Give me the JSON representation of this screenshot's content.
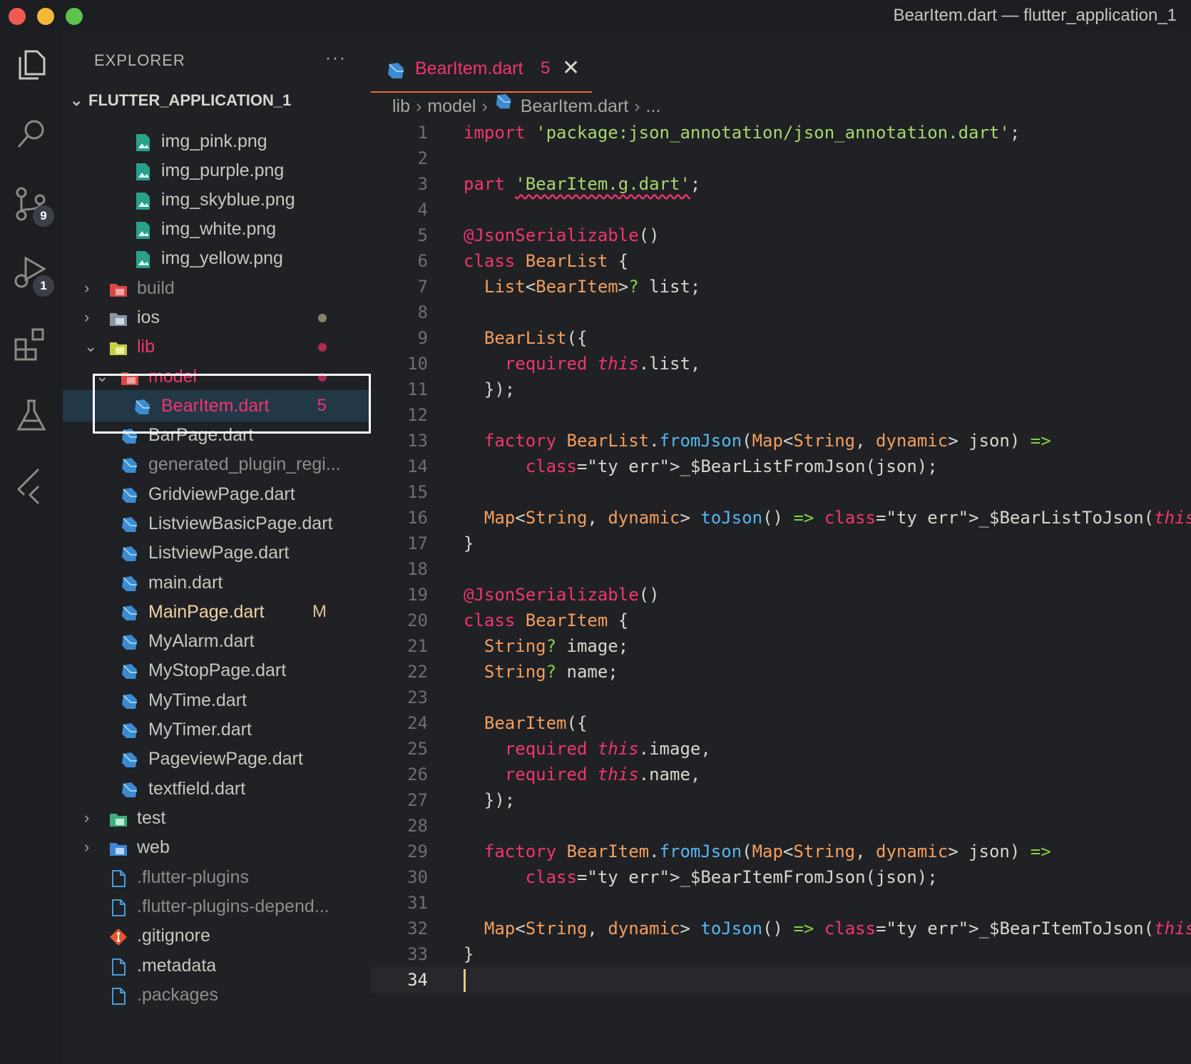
{
  "window": {
    "title": "BearItem.dart — flutter_application_1"
  },
  "activity_bar": {
    "source_control_badge": "9",
    "run_debug_badge": "1"
  },
  "explorer": {
    "header": "EXPLORER",
    "more_label": "···",
    "project": "FLUTTER_APPLICATION_1",
    "items": [
      {
        "label": "img_pink.png"
      },
      {
        "label": "img_purple.png"
      },
      {
        "label": "img_skyblue.png"
      },
      {
        "label": "img_white.png"
      },
      {
        "label": "img_yellow.png"
      },
      {
        "label": "build"
      },
      {
        "label": "ios"
      },
      {
        "label": "lib"
      },
      {
        "label": "model"
      },
      {
        "label": "BearItem.dart",
        "badge": "5"
      },
      {
        "label": "BarPage.dart"
      },
      {
        "label": "generated_plugin_regi..."
      },
      {
        "label": "GridviewPage.dart"
      },
      {
        "label": "ListviewBasicPage.dart"
      },
      {
        "label": "ListviewPage.dart"
      },
      {
        "label": "main.dart"
      },
      {
        "label": "MainPage.dart",
        "badge": "M"
      },
      {
        "label": "MyAlarm.dart"
      },
      {
        "label": "MyStopPage.dart"
      },
      {
        "label": "MyTime.dart"
      },
      {
        "label": "MyTimer.dart"
      },
      {
        "label": "PageviewPage.dart"
      },
      {
        "label": "textfield.dart"
      },
      {
        "label": "test"
      },
      {
        "label": "web"
      },
      {
        "label": ".flutter-plugins"
      },
      {
        "label": ".flutter-plugins-depend..."
      },
      {
        "label": ".gitignore"
      },
      {
        "label": ".metadata"
      },
      {
        "label": ".packages"
      }
    ]
  },
  "tab": {
    "name": "BearItem.dart",
    "problems": "5",
    "close": "✕"
  },
  "breadcrumb": {
    "lib": "lib",
    "model": "model",
    "file": "BearItem.dart",
    "more": "..."
  },
  "editor": {
    "current_line": "34",
    "lines": [
      {
        "n": "1",
        "t": "import 'package:json_annotation/json_annotation.dart';"
      },
      {
        "n": "2",
        "t": ""
      },
      {
        "n": "3",
        "t": "part 'BearItem.g.dart';"
      },
      {
        "n": "4",
        "t": ""
      },
      {
        "n": "5",
        "t": "@JsonSerializable()"
      },
      {
        "n": "6",
        "t": "class BearList {"
      },
      {
        "n": "7",
        "t": "  List<BearItem>? list;"
      },
      {
        "n": "8",
        "t": ""
      },
      {
        "n": "9",
        "t": "  BearList({"
      },
      {
        "n": "10",
        "t": "    required this.list,"
      },
      {
        "n": "11",
        "t": "  });"
      },
      {
        "n": "12",
        "t": ""
      },
      {
        "n": "13",
        "t": "  factory BearList.fromJson(Map<String, dynamic> json) =>"
      },
      {
        "n": "14",
        "t": "      _$BearListFromJson(json);"
      },
      {
        "n": "15",
        "t": ""
      },
      {
        "n": "16",
        "t": "  Map<String, dynamic> toJson() => _$BearListToJson(this);"
      },
      {
        "n": "17",
        "t": "}"
      },
      {
        "n": "18",
        "t": ""
      },
      {
        "n": "19",
        "t": "@JsonSerializable()"
      },
      {
        "n": "20",
        "t": "class BearItem {"
      },
      {
        "n": "21",
        "t": "  String? image;"
      },
      {
        "n": "22",
        "t": "  String? name;"
      },
      {
        "n": "23",
        "t": ""
      },
      {
        "n": "24",
        "t": "  BearItem({"
      },
      {
        "n": "25",
        "t": "    required this.image,"
      },
      {
        "n": "26",
        "t": "    required this.name,"
      },
      {
        "n": "27",
        "t": "  });"
      },
      {
        "n": "28",
        "t": ""
      },
      {
        "n": "29",
        "t": "  factory BearItem.fromJson(Map<String, dynamic> json) =>"
      },
      {
        "n": "30",
        "t": "      _$BearItemFromJson(json);"
      },
      {
        "n": "31",
        "t": ""
      },
      {
        "n": "32",
        "t": "  Map<String, dynamic> toJson() => _$BearItemToJson(this);"
      },
      {
        "n": "33",
        "t": "}"
      },
      {
        "n": "34",
        "t": ""
      }
    ]
  },
  "colors": {
    "background": "#1f2125",
    "keyword": "#f2356e",
    "string": "#a9d66b",
    "type": "#f59e5b",
    "function": "#58b6f0",
    "tab_underline": "#e86b3a"
  }
}
